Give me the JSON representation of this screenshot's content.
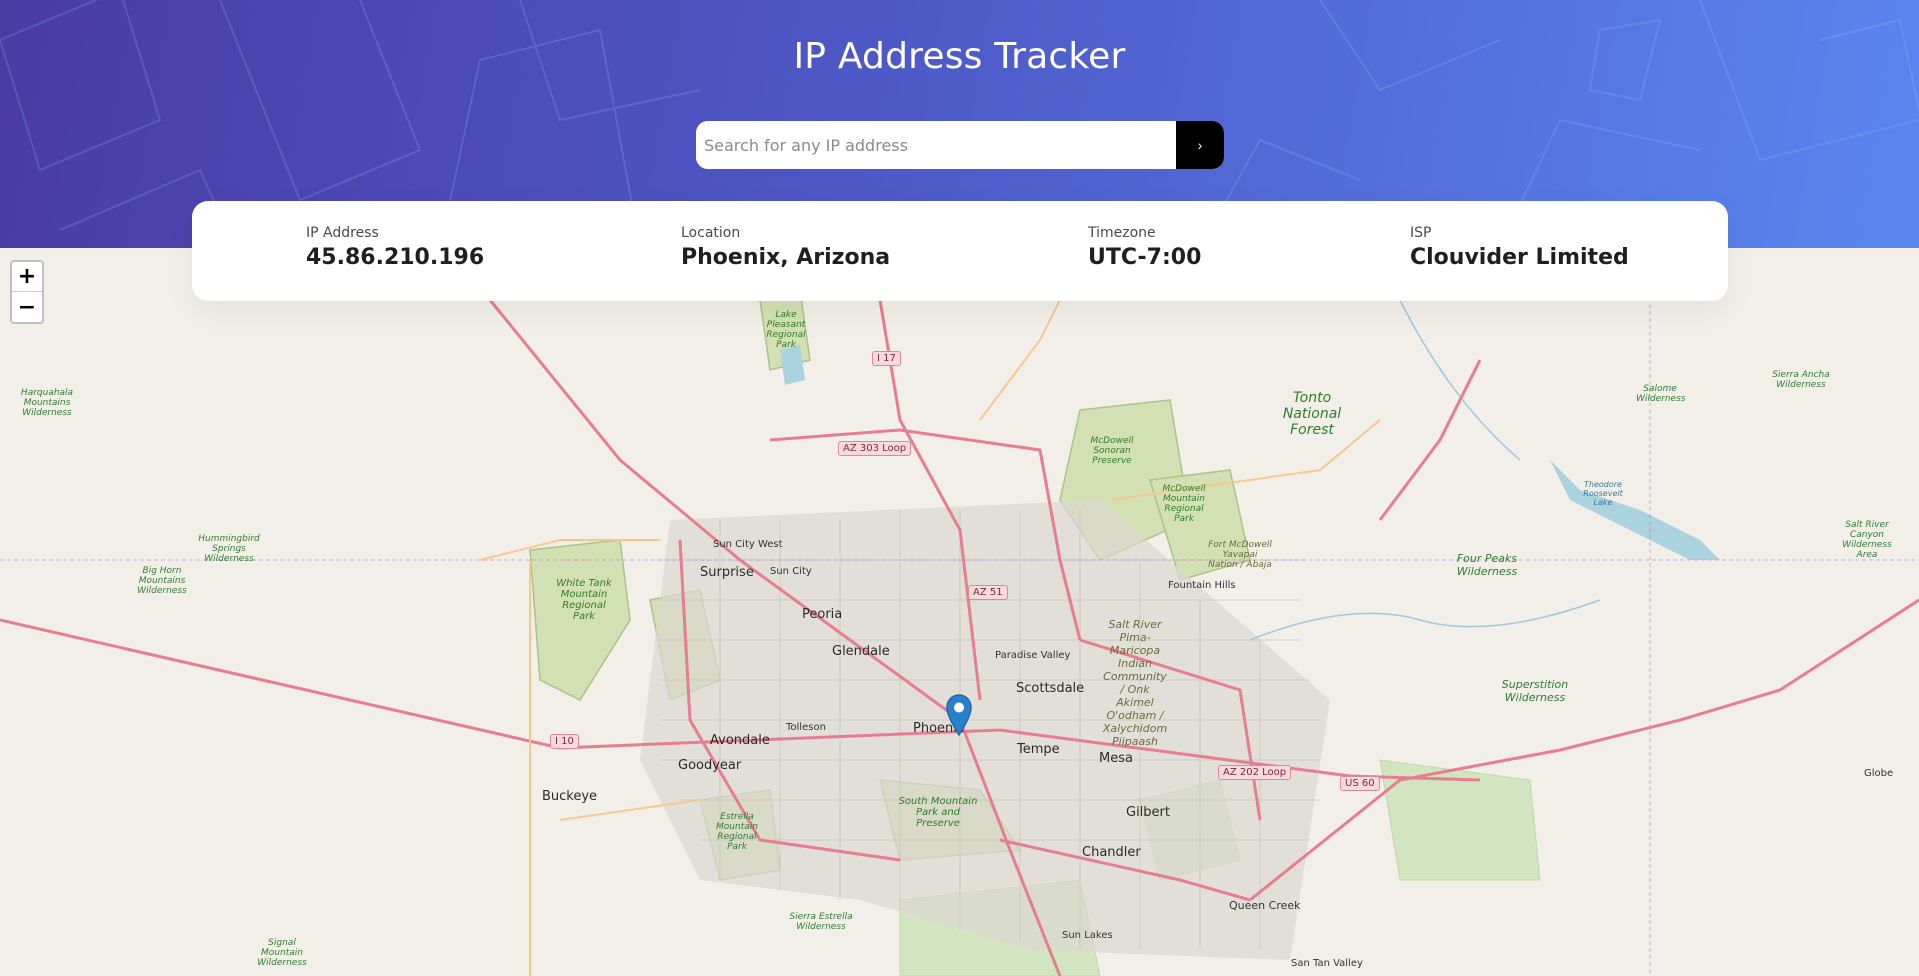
{
  "header": {
    "title": "IP Address Tracker",
    "search_placeholder": "Search for any IP address",
    "submit_glyph": "›"
  },
  "info": {
    "ip": {
      "label": "IP Address",
      "value": "45.86.210.196"
    },
    "location": {
      "label": "Location",
      "value": "Phoenix, Arizona"
    },
    "timezone": {
      "label": "Timezone",
      "value": "UTC-7:00"
    },
    "isp": {
      "label": "ISP",
      "value": "Clouvider Limited"
    }
  },
  "map": {
    "zoom_in": "+",
    "zoom_out": "−",
    "marker_icon": "map-pin-icon",
    "cities": [
      "Phoenix",
      "Scottsdale",
      "Tempe",
      "Mesa",
      "Glendale",
      "Peoria",
      "Surprise",
      "Sun City",
      "Sun City West",
      "Avondale",
      "Goodyear",
      "Buckeye",
      "Tolleson",
      "Gilbert",
      "Chandler",
      "Paradise Valley",
      "Fountain Hills",
      "Queen Creek",
      "Sun Lakes",
      "San Tan Valley",
      "Globe"
    ],
    "areas": [
      "Tonto National Forest",
      "McDowell Sonoran Preserve",
      "McDowell Mountain Regional Park",
      "White Tank Mountain Regional Park",
      "Lake Pleasant Regional Park",
      "Salt River Pima-Maricopa Indian Community / Onk Akimel O'odham / Xalychidom Piipaash",
      "South Mountain Park and Preserve",
      "Estrella Mountain Regional Park",
      "Four Peaks Wilderness",
      "Superstition Wilderness",
      "Hummingbird Springs Wilderness",
      "Big Horn Mountains Wilderness",
      "Harquahala Mountains Wilderness",
      "Salome Wilderness",
      "Sierra Ancha Wilderness",
      "Salt River Canyon Wilderness Area",
      "Theodore Roosevelt Lake",
      "Fort McDowell Yavapai Nation / Abaja",
      "Sierra Estrella Wilderness",
      "Signal Mountain Wilderness"
    ],
    "roads": [
      "I 17",
      "AZ 303 Loop",
      "AZ 51",
      "I 10",
      "AZ 202 Loop",
      "US 60"
    ]
  }
}
